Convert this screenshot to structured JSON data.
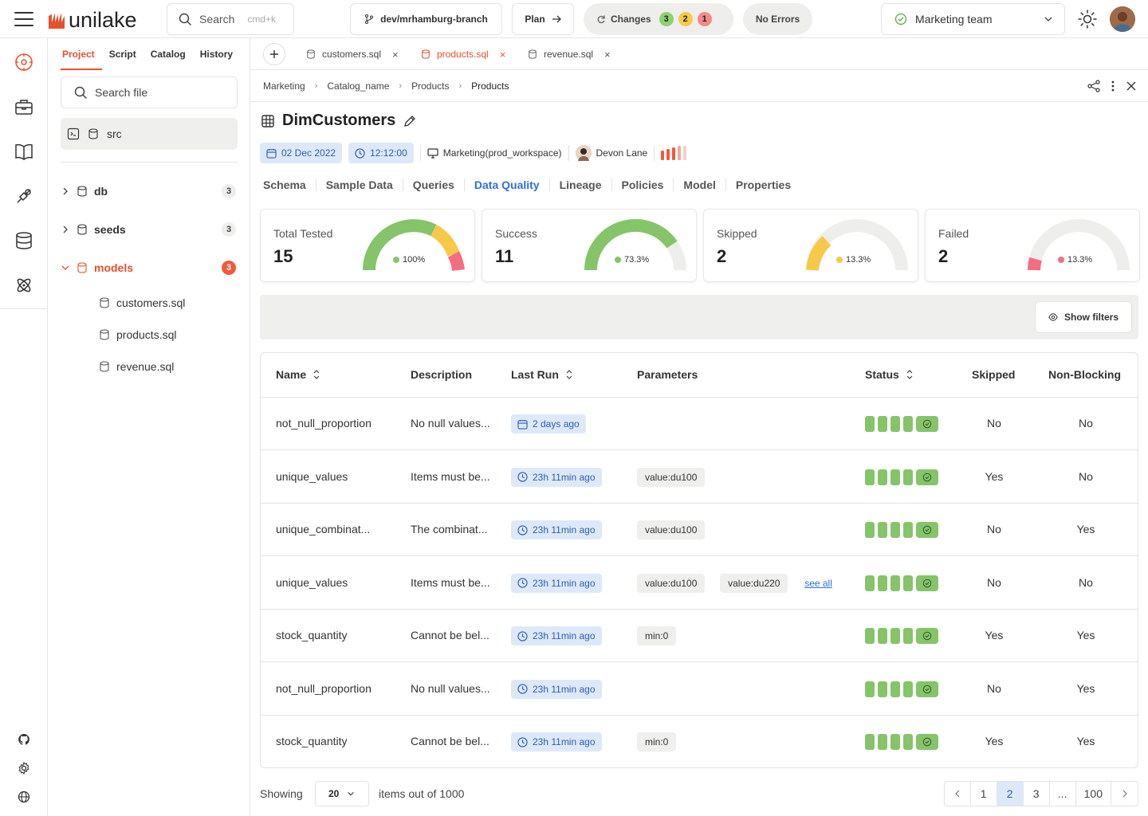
{
  "app": {
    "logo_text": "unilake",
    "brand_color": "#e5512e"
  },
  "topbar": {
    "search_label": "Search",
    "search_hint": "cmd+k",
    "branch": "dev/mrhamburg-branch",
    "plan_label": "Plan",
    "changes_label": "Changes",
    "changes_counts": [
      {
        "value": "3",
        "color": "#8fd16f"
      },
      {
        "value": "2",
        "color": "#f7c948"
      },
      {
        "value": "1",
        "color": "#f38a8a"
      }
    ],
    "errors_label": "No Errors",
    "team_label": "Marketing team"
  },
  "project_panel": {
    "tabs": [
      "Project",
      "Script",
      "Catalog",
      "History"
    ],
    "active_tab": "Project",
    "search_placeholder": "Search file",
    "root": "src",
    "folders": [
      {
        "name": "db",
        "count": "3"
      },
      {
        "name": "seeds",
        "count": "3"
      },
      {
        "name": "models",
        "count": "3"
      }
    ],
    "files": [
      "customers.sql",
      "products.sql",
      "revenue.sql"
    ]
  },
  "file_tabs": [
    {
      "name": "customers.sql",
      "active": false
    },
    {
      "name": "products.sql",
      "active": true
    },
    {
      "name": "revenue.sql",
      "active": false
    }
  ],
  "breadcrumb": [
    "Marketing",
    "Catalog_name",
    "Products",
    "Products"
  ],
  "entity": {
    "title": "DimCustomers",
    "date": "02 Dec 2022",
    "time": "12:12:00",
    "workspace": "Marketing(prod_workspace)",
    "owner": "Devon Lane"
  },
  "tabs": [
    "Schema",
    "Sample Data",
    "Queries",
    "Data Quality",
    "Lineage",
    "Policies",
    "Model",
    "Properties"
  ],
  "active_tab": "Data Quality",
  "stats": [
    {
      "label": "Total Tested",
      "value": "15",
      "percent": "100%",
      "dot_color": "#86c46a"
    },
    {
      "label": "Success",
      "value": "11",
      "percent": "73.3%",
      "dot_color": "#86c46a"
    },
    {
      "label": "Skipped",
      "value": "2",
      "percent": "13.3%",
      "dot_color": "#f7c948"
    },
    {
      "label": "Failed",
      "value": "2",
      "percent": "13.3%",
      "dot_color": "#f36f7f"
    }
  ],
  "filters": {
    "show_label": "Show filters"
  },
  "table": {
    "columns": [
      "Name",
      "Description",
      "Last Run",
      "Parameters",
      "Status",
      "Skipped",
      "Non-Blocking"
    ],
    "rows": [
      {
        "name": "not_null_proportion",
        "description": "No null values...",
        "last_run": "2 days ago",
        "params": [],
        "see_all": "",
        "skipped": "No",
        "non_blocking": "No"
      },
      {
        "name": "unique_values",
        "description": "Items must be...",
        "last_run": "23h 11min ago",
        "params": [
          "value:du100"
        ],
        "see_all": "",
        "skipped": "Yes",
        "non_blocking": "No"
      },
      {
        "name": "unique_combinat...",
        "description": "The combinat...",
        "last_run": "23h 11min ago",
        "params": [
          "value:du100"
        ],
        "see_all": "",
        "skipped": "No",
        "non_blocking": "Yes"
      },
      {
        "name": "unique_values",
        "description": "Items must be...",
        "last_run": "23h 11min ago",
        "params": [
          "value:du100",
          "value:du220"
        ],
        "see_all": "see all",
        "skipped": "No",
        "non_blocking": "No"
      },
      {
        "name": "stock_quantity",
        "description": "Cannot be bel...",
        "last_run": "23h 11min ago",
        "params": [
          "min:0"
        ],
        "see_all": "",
        "skipped": "Yes",
        "non_blocking": "Yes"
      },
      {
        "name": "not_null_proportion",
        "description": "No null values...",
        "last_run": "23h 11min ago",
        "params": [],
        "see_all": "",
        "skipped": "No",
        "non_blocking": "Yes"
      },
      {
        "name": "stock_quantity",
        "description": "Cannot be bel...",
        "last_run": "23h 11min ago",
        "params": [
          "min:0"
        ],
        "see_all": "",
        "skipped": "Yes",
        "non_blocking": "Yes"
      }
    ]
  },
  "pagination": {
    "showing_label": "Showing",
    "page_size": "20",
    "items_label": "items out of 1000",
    "pages": [
      "1",
      "2",
      "3",
      "...",
      "100"
    ],
    "active_page": "2"
  }
}
